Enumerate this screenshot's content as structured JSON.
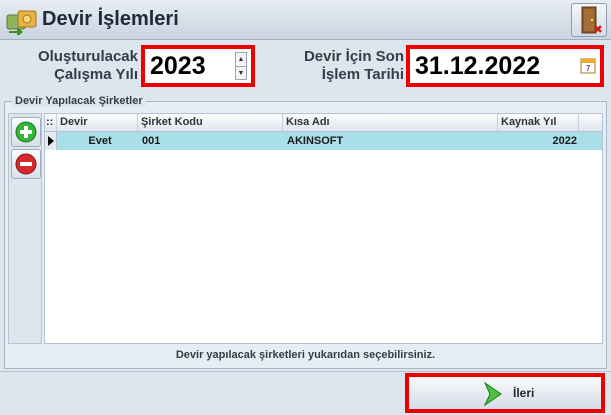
{
  "window": {
    "title": "Devir İşlemleri",
    "app_icon": "money-transfer-icon",
    "close_icon": "exit-door-icon"
  },
  "form": {
    "year_label": "Oluşturulacak Çalışma Yılı",
    "year_value": "2023",
    "date_label": "Devir İçin Son İşlem Tarihi",
    "date_value": "31.12.2022",
    "calendar_icon": "calendar-icon"
  },
  "group": {
    "title": "Devir Yapılacak Şirketler",
    "add_icon": "add-icon",
    "remove_icon": "remove-icon"
  },
  "table": {
    "columns": [
      "Devir",
      "Şirket Kodu",
      "Kısa Adı",
      "Kaynak Yıl"
    ],
    "rows": [
      {
        "devir": "Evet",
        "sirket_kodu": "001",
        "kisa_adi": "AKINSOFT",
        "kaynak_yil": "2022"
      }
    ]
  },
  "hint": "Devir yapılacak şirketleri yukarıdan seçebilirsiniz.",
  "next_button": {
    "label": "İleri",
    "icon": "arrow-right-icon"
  },
  "colors": {
    "highlight": "#ee0000",
    "row_selected": "#a9dfe9"
  }
}
